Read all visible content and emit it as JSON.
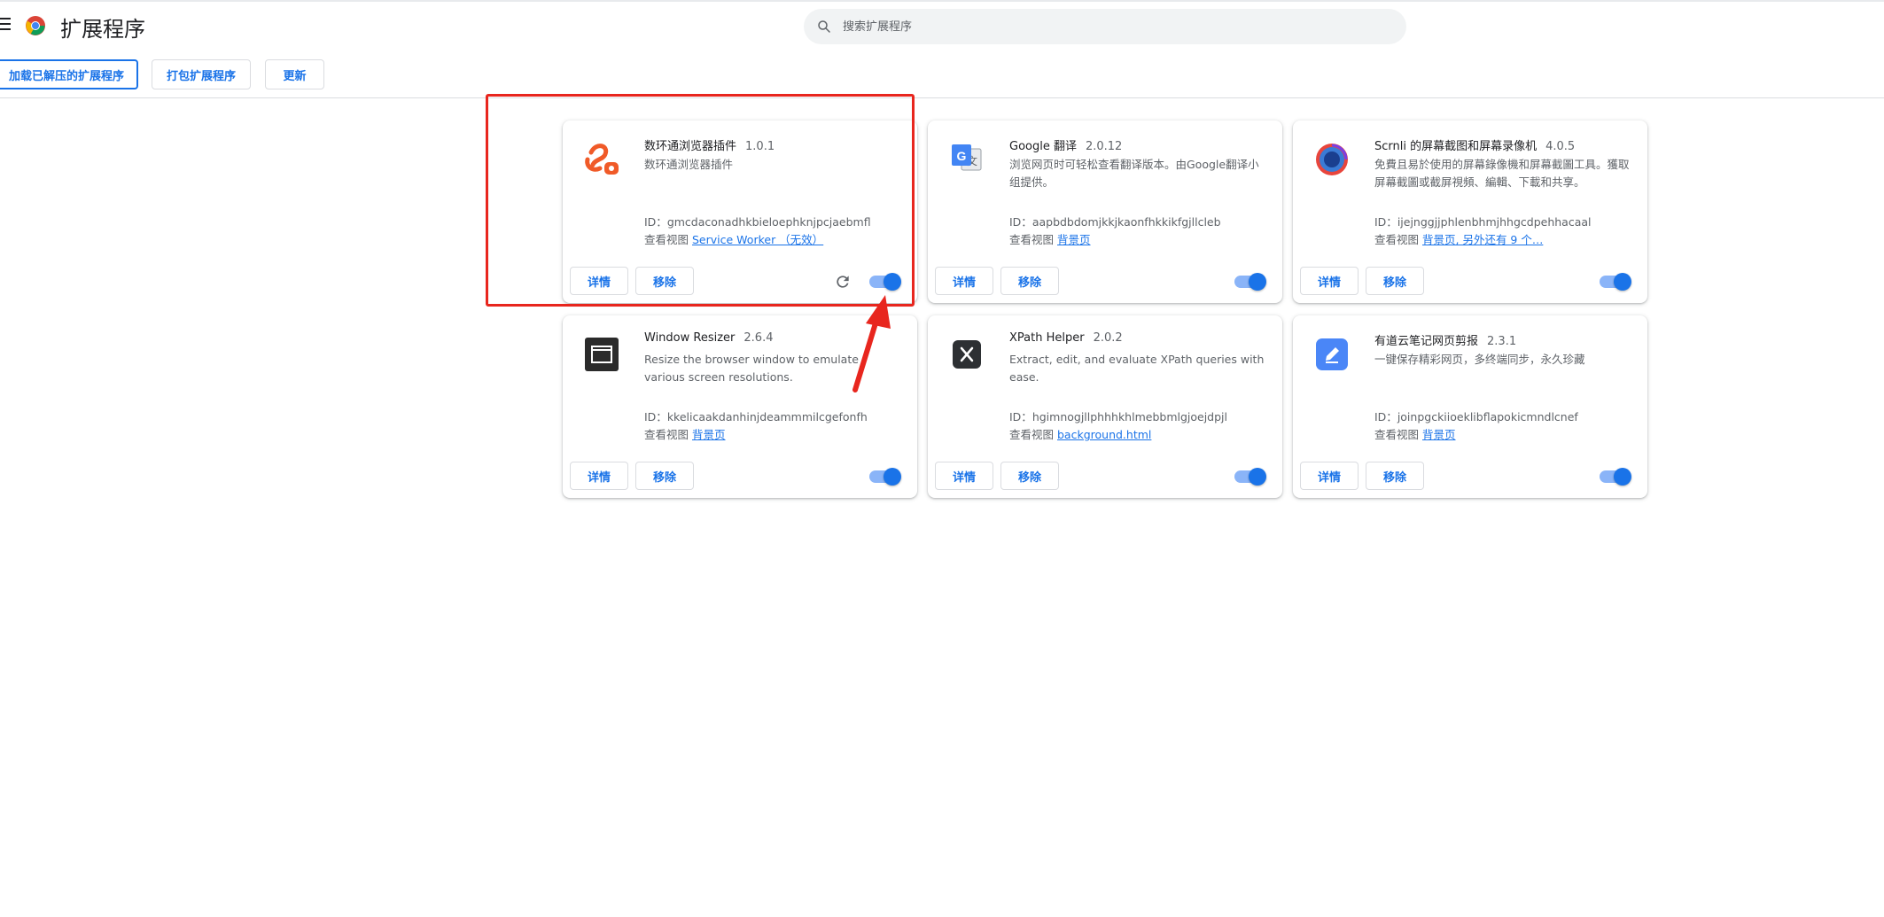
{
  "header": {
    "title": "扩展程序",
    "search_placeholder": "搜索扩展程序"
  },
  "toolbar": {
    "load_unpacked": "加载已解压的扩展程序",
    "pack": "打包扩展程序",
    "update": "更新"
  },
  "common": {
    "details": "详情",
    "remove": "移除",
    "id_prefix": "ID：",
    "view_prefix": "查看视图"
  },
  "extensions": [
    {
      "name": "数环通浏览器插件",
      "version": "1.0.1",
      "description": "数环通浏览器插件",
      "id": "gmcdaconadhkbieloephknjpcjaebmfl",
      "view_link": "Service Worker （无效）",
      "enabled": true,
      "icon": "shuhuantong-icon"
    },
    {
      "name": "Google 翻译",
      "version": "2.0.12",
      "description": "浏览网页时可轻松查看翻译版本。由Google翻译小组提供。",
      "id": "aapbdbdomjkkjkaonfhkkikfgjllcleb",
      "view_link": "背景页",
      "enabled": true,
      "icon": "google-translate-icon"
    },
    {
      "name": "Scrnli 的屏幕截图和屏幕录像机",
      "version": "4.0.5",
      "description": "免費且易於使用的屏幕錄像機和屏幕截圖工具。獲取屏幕截圖或截屏視頻、編輯、下載和共享。",
      "id": "ijejnggjjphlenbhmjhhgcdpehhacaal",
      "view_link": "背景页, 另外还有 9 个…",
      "enabled": true,
      "icon": "scrnli-icon"
    },
    {
      "name": "Window Resizer",
      "version": "2.6.4",
      "description": "Resize the browser window to emulate various screen resolutions.",
      "id": "kkelicaakdanhinjdeammmilcgefonfh",
      "view_link": "背景页",
      "enabled": true,
      "icon": "window-resizer-icon"
    },
    {
      "name": "XPath Helper",
      "version": "2.0.2",
      "description": "Extract, edit, and evaluate XPath queries with ease.",
      "id": "hgimnogjllphhhkhlmebbmlgjoejdpjl",
      "view_link": "background.html",
      "enabled": true,
      "icon": "xpath-helper-icon"
    },
    {
      "name": "有道云笔记网页剪报",
      "version": "2.3.1",
      "description": "一键保存精彩网页，多终端同步，永久珍藏",
      "id": "joinpgckiioeklibflapokicmndlcnef",
      "view_link": "背景页",
      "enabled": true,
      "icon": "youdao-note-icon"
    }
  ],
  "colors": {
    "accent": "#1a73e8",
    "annotation": "#e8261e"
  }
}
